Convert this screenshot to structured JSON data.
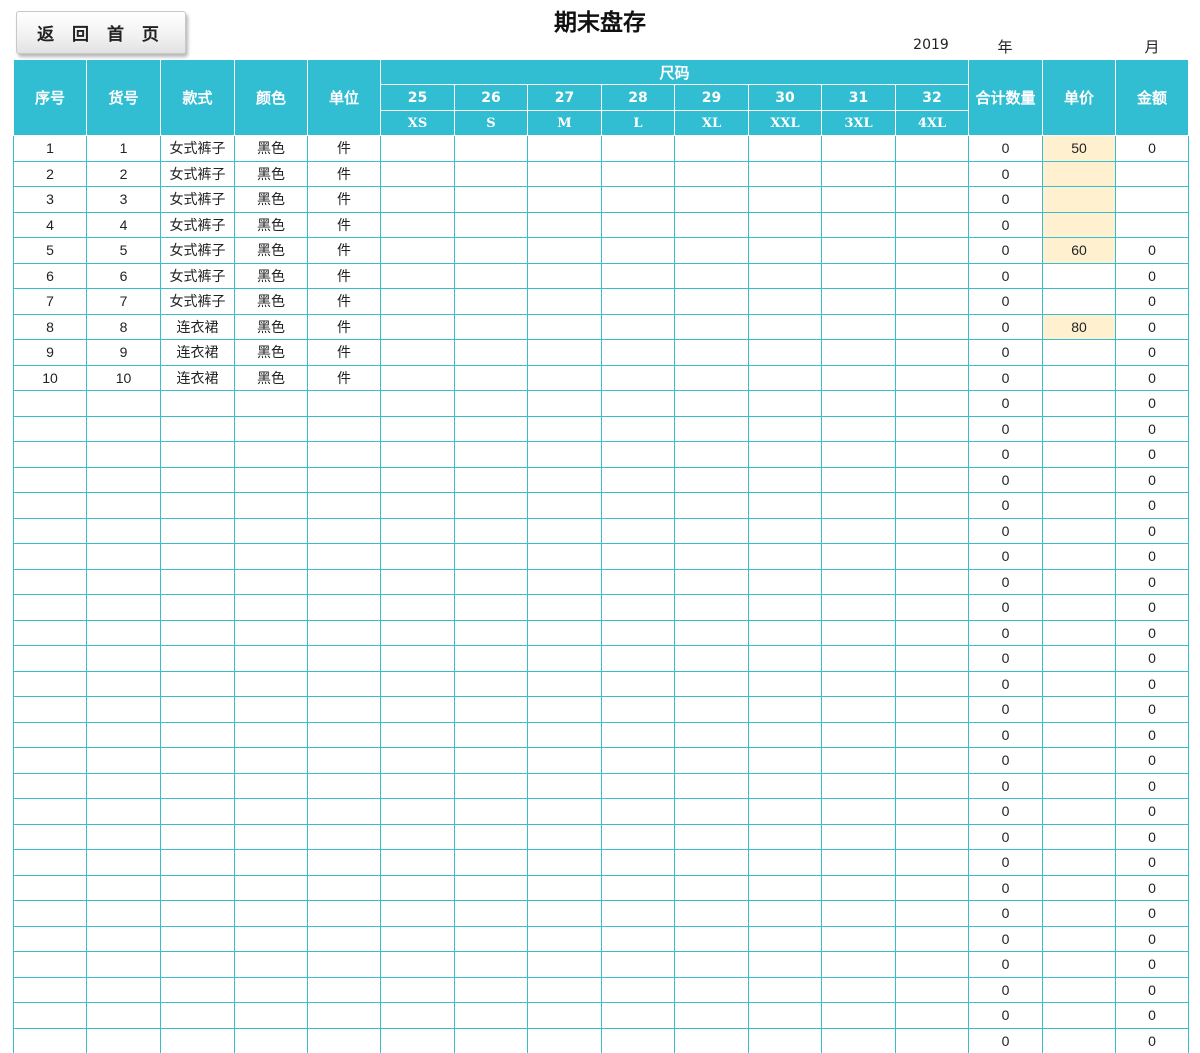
{
  "toolbar": {
    "back_label": "返 回 首 页"
  },
  "page": {
    "title": "期末盘存",
    "year_value": "2019",
    "year_label": "年",
    "month_label": "月"
  },
  "table": {
    "headers": {
      "seq": "序号",
      "item_no": "货号",
      "style": "款式",
      "color": "颜色",
      "unit": "单位",
      "size_group": "尺码",
      "total_qty": "合计数量",
      "unit_price": "单价",
      "amount": "金额"
    },
    "sizes": [
      "25",
      "26",
      "27",
      "28",
      "29",
      "30",
      "31",
      "32"
    ],
    "size_letters": [
      "XS",
      "S",
      "M",
      "L",
      "XL",
      "XXL",
      "3XL",
      "4XL"
    ],
    "rows": [
      {
        "seq": "1",
        "item_no": "1",
        "style": "女式裤子",
        "color": "黑色",
        "unit": "件",
        "total": "0",
        "price": "50",
        "amount": "0"
      },
      {
        "seq": "2",
        "item_no": "2",
        "style": "女式裤子",
        "color": "黑色",
        "unit": "件",
        "total": "0",
        "price": "",
        "amount": ""
      },
      {
        "seq": "3",
        "item_no": "3",
        "style": "女式裤子",
        "color": "黑色",
        "unit": "件",
        "total": "0",
        "price": "",
        "amount": ""
      },
      {
        "seq": "4",
        "item_no": "4",
        "style": "女式裤子",
        "color": "黑色",
        "unit": "件",
        "total": "0",
        "price": "",
        "amount": ""
      },
      {
        "seq": "5",
        "item_no": "5",
        "style": "女式裤子",
        "color": "黑色",
        "unit": "件",
        "total": "0",
        "price": "60",
        "amount": "0"
      },
      {
        "seq": "6",
        "item_no": "6",
        "style": "女式裤子",
        "color": "黑色",
        "unit": "件",
        "total": "0",
        "price": "",
        "amount": "0"
      },
      {
        "seq": "7",
        "item_no": "7",
        "style": "女式裤子",
        "color": "黑色",
        "unit": "件",
        "total": "0",
        "price": "",
        "amount": "0"
      },
      {
        "seq": "8",
        "item_no": "8",
        "style": "连衣裙",
        "color": "黑色",
        "unit": "件",
        "total": "0",
        "price": "80",
        "amount": "0"
      },
      {
        "seq": "9",
        "item_no": "9",
        "style": "连衣裙",
        "color": "黑色",
        "unit": "件",
        "total": "0",
        "price": "",
        "amount": "0"
      },
      {
        "seq": "10",
        "item_no": "10",
        "style": "连衣裙",
        "color": "黑色",
        "unit": "件",
        "total": "0",
        "price": "",
        "amount": "0"
      },
      {
        "seq": "",
        "item_no": "",
        "style": "",
        "color": "",
        "unit": "",
        "total": "0",
        "price": "",
        "amount": "0"
      },
      {
        "seq": "",
        "item_no": "",
        "style": "",
        "color": "",
        "unit": "",
        "total": "0",
        "price": "",
        "amount": "0"
      },
      {
        "seq": "",
        "item_no": "",
        "style": "",
        "color": "",
        "unit": "",
        "total": "0",
        "price": "",
        "amount": "0"
      },
      {
        "seq": "",
        "item_no": "",
        "style": "",
        "color": "",
        "unit": "",
        "total": "0",
        "price": "",
        "amount": "0"
      },
      {
        "seq": "",
        "item_no": "",
        "style": "",
        "color": "",
        "unit": "",
        "total": "0",
        "price": "",
        "amount": "0"
      },
      {
        "seq": "",
        "item_no": "",
        "style": "",
        "color": "",
        "unit": "",
        "total": "0",
        "price": "",
        "amount": "0"
      },
      {
        "seq": "",
        "item_no": "",
        "style": "",
        "color": "",
        "unit": "",
        "total": "0",
        "price": "",
        "amount": "0"
      },
      {
        "seq": "",
        "item_no": "",
        "style": "",
        "color": "",
        "unit": "",
        "total": "0",
        "price": "",
        "amount": "0"
      },
      {
        "seq": "",
        "item_no": "",
        "style": "",
        "color": "",
        "unit": "",
        "total": "0",
        "price": "",
        "amount": "0"
      },
      {
        "seq": "",
        "item_no": "",
        "style": "",
        "color": "",
        "unit": "",
        "total": "0",
        "price": "",
        "amount": "0"
      },
      {
        "seq": "",
        "item_no": "",
        "style": "",
        "color": "",
        "unit": "",
        "total": "0",
        "price": "",
        "amount": "0"
      },
      {
        "seq": "",
        "item_no": "",
        "style": "",
        "color": "",
        "unit": "",
        "total": "0",
        "price": "",
        "amount": "0"
      },
      {
        "seq": "",
        "item_no": "",
        "style": "",
        "color": "",
        "unit": "",
        "total": "0",
        "price": "",
        "amount": "0"
      },
      {
        "seq": "",
        "item_no": "",
        "style": "",
        "color": "",
        "unit": "",
        "total": "0",
        "price": "",
        "amount": "0"
      },
      {
        "seq": "",
        "item_no": "",
        "style": "",
        "color": "",
        "unit": "",
        "total": "0",
        "price": "",
        "amount": "0"
      },
      {
        "seq": "",
        "item_no": "",
        "style": "",
        "color": "",
        "unit": "",
        "total": "0",
        "price": "",
        "amount": "0"
      },
      {
        "seq": "",
        "item_no": "",
        "style": "",
        "color": "",
        "unit": "",
        "total": "0",
        "price": "",
        "amount": "0"
      },
      {
        "seq": "",
        "item_no": "",
        "style": "",
        "color": "",
        "unit": "",
        "total": "0",
        "price": "",
        "amount": "0"
      },
      {
        "seq": "",
        "item_no": "",
        "style": "",
        "color": "",
        "unit": "",
        "total": "0",
        "price": "",
        "amount": "0"
      },
      {
        "seq": "",
        "item_no": "",
        "style": "",
        "color": "",
        "unit": "",
        "total": "0",
        "price": "",
        "amount": "0"
      },
      {
        "seq": "",
        "item_no": "",
        "style": "",
        "color": "",
        "unit": "",
        "total": "0",
        "price": "",
        "amount": "0"
      },
      {
        "seq": "",
        "item_no": "",
        "style": "",
        "color": "",
        "unit": "",
        "total": "0",
        "price": "",
        "amount": "0"
      },
      {
        "seq": "",
        "item_no": "",
        "style": "",
        "color": "",
        "unit": "",
        "total": "0",
        "price": "",
        "amount": "0"
      },
      {
        "seq": "",
        "item_no": "",
        "style": "",
        "color": "",
        "unit": "",
        "total": "0",
        "price": "",
        "amount": "0"
      },
      {
        "seq": "",
        "item_no": "",
        "style": "",
        "color": "",
        "unit": "",
        "total": "0",
        "price": "",
        "amount": "0"
      },
      {
        "seq": "",
        "item_no": "",
        "style": "",
        "color": "",
        "unit": "",
        "total": "0",
        "price": "",
        "amount": "0"
      }
    ]
  },
  "colors": {
    "header_bg": "#31bdd2",
    "grid_line": "#3bbccd",
    "price_fill": "#fff1cf",
    "price_text": "#b23a2a"
  }
}
